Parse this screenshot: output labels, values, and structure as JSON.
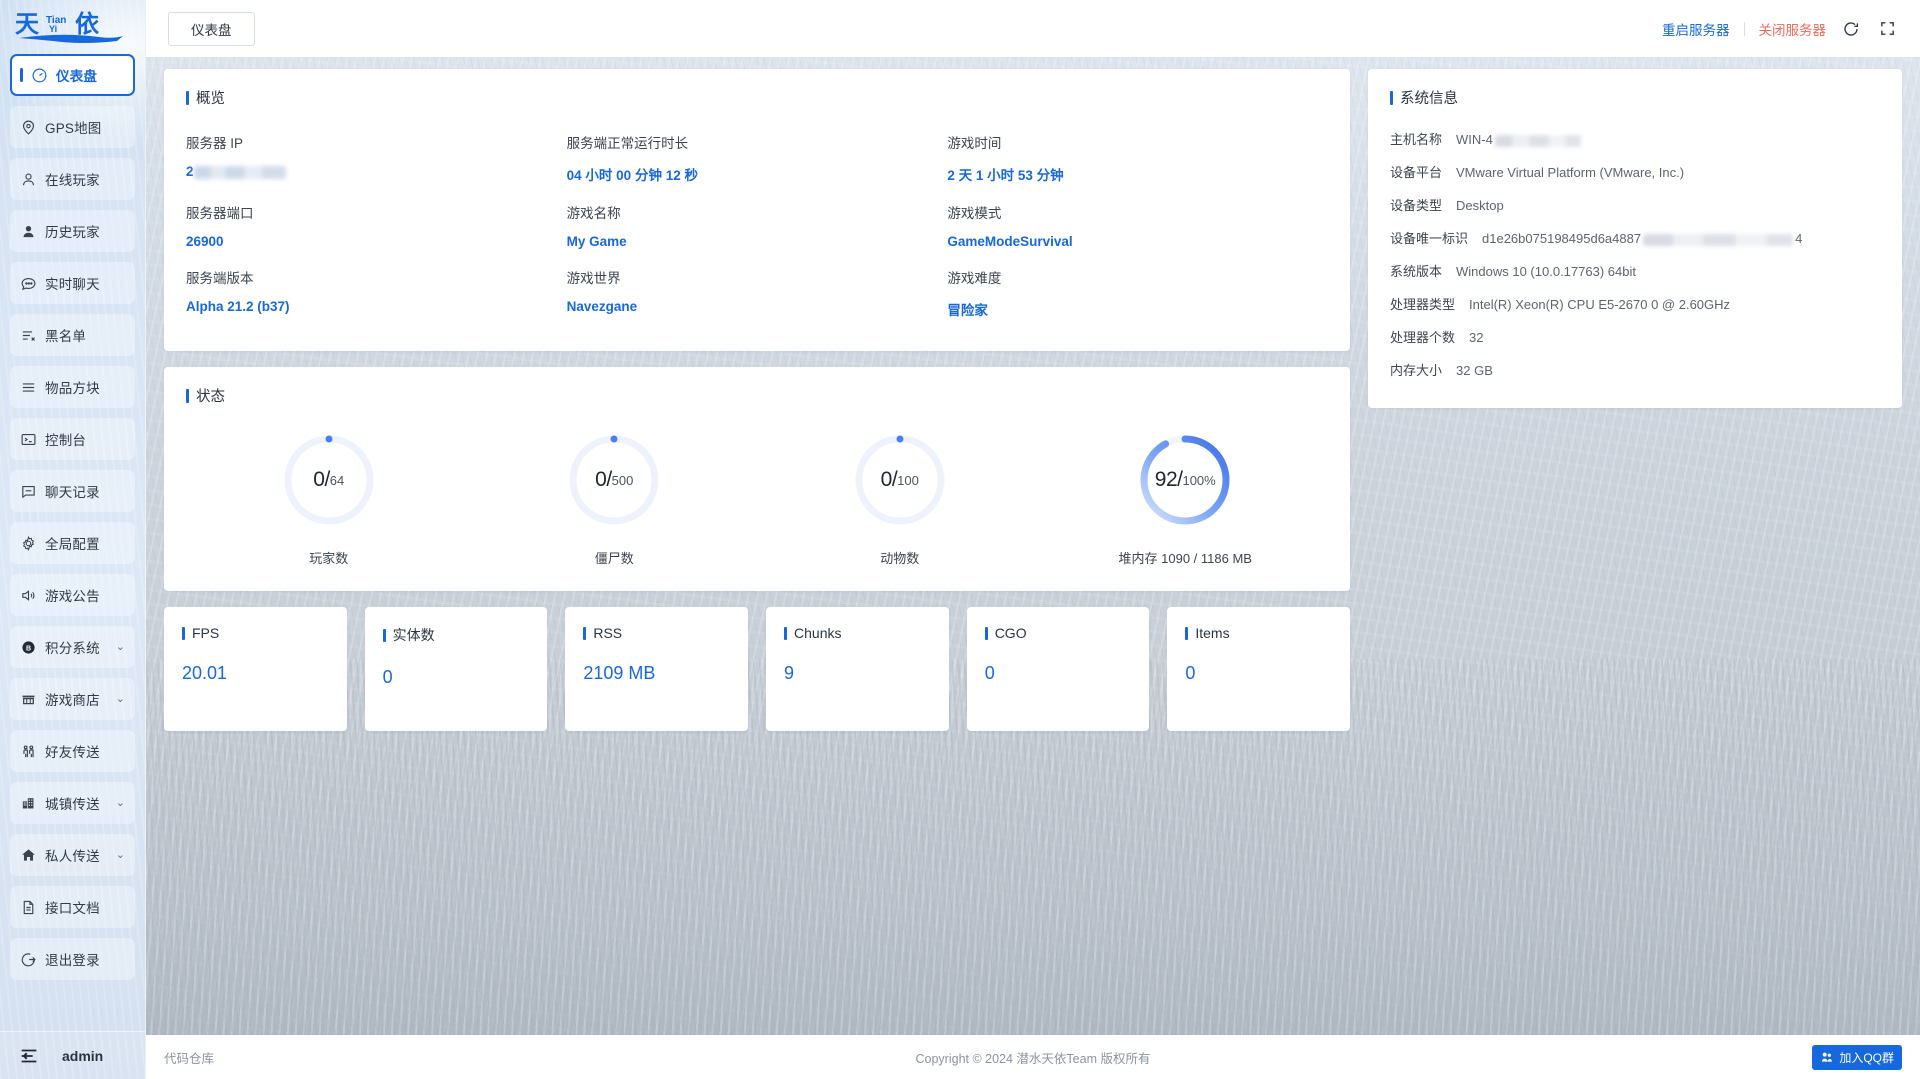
{
  "brand": {
    "logo_primary": "天",
    "logo_pinyin_top": "TIAN",
    "logo_pinyin_bottom": "YI",
    "logo_secondary": "依"
  },
  "sidebar": {
    "items": [
      {
        "label": "仪表盘",
        "icon": "gauge-icon",
        "active": true,
        "expandable": false
      },
      {
        "label": "GPS地图",
        "icon": "map-pin-icon",
        "active": false,
        "expandable": false
      },
      {
        "label": "在线玩家",
        "icon": "user-icon",
        "active": false,
        "expandable": false
      },
      {
        "label": "历史玩家",
        "icon": "user-solid-icon",
        "active": false,
        "expandable": false
      },
      {
        "label": "实时聊天",
        "icon": "chat-icon",
        "active": false,
        "expandable": false
      },
      {
        "label": "黑名单",
        "icon": "list-x-icon",
        "active": false,
        "expandable": false
      },
      {
        "label": "物品方块",
        "icon": "menu-lines-icon",
        "active": false,
        "expandable": false
      },
      {
        "label": "控制台",
        "icon": "terminal-icon",
        "active": false,
        "expandable": false
      },
      {
        "label": "聊天记录",
        "icon": "message-icon",
        "active": false,
        "expandable": false
      },
      {
        "label": "全局配置",
        "icon": "gear-icon",
        "active": false,
        "expandable": false
      },
      {
        "label": "游戏公告",
        "icon": "speaker-icon",
        "active": false,
        "expandable": false
      },
      {
        "label": "积分系统",
        "icon": "coin-icon",
        "active": false,
        "expandable": true
      },
      {
        "label": "游戏商店",
        "icon": "shop-icon",
        "active": false,
        "expandable": true
      },
      {
        "label": "好友传送",
        "icon": "friends-icon",
        "active": false,
        "expandable": false
      },
      {
        "label": "城镇传送",
        "icon": "city-icon",
        "active": false,
        "expandable": true
      },
      {
        "label": "私人传送",
        "icon": "home-icon",
        "active": false,
        "expandable": true
      },
      {
        "label": "接口文档",
        "icon": "doc-icon",
        "active": false,
        "expandable": false
      },
      {
        "label": "退出登录",
        "icon": "logout-icon",
        "active": false,
        "expandable": false
      }
    ],
    "footer": {
      "collapse_icon": "collapse-icon",
      "user": "admin"
    }
  },
  "topbar": {
    "tab_label": "仪表盘",
    "restart_label": "重启服务器",
    "shutdown_label": "关闭服务器",
    "refresh_icon": "refresh-icon",
    "fullscreen_icon": "fullscreen-icon",
    "restart_color": "#1668dc",
    "shutdown_color": "#f26a5d"
  },
  "overview": {
    "title": "概览",
    "fields": [
      {
        "label": "服务器 IP",
        "value": "2",
        "masked": true,
        "type": "ip"
      },
      {
        "label": "服务端正常运行时长",
        "value": "04 小时 00 分钟 12 秒",
        "masked": false,
        "type": "text"
      },
      {
        "label": "游戏时间",
        "value": "2 天 1 小时 53 分钟",
        "masked": false,
        "type": "text"
      },
      {
        "label": "服务器端口",
        "value": "26900",
        "masked": false,
        "type": "text"
      },
      {
        "label": "游戏名称",
        "value": "My Game",
        "masked": false,
        "type": "text"
      },
      {
        "label": "游戏模式",
        "value": "GameModeSurvival",
        "masked": false,
        "type": "text"
      },
      {
        "label": "服务端版本",
        "value": "Alpha 21.2 (b37)",
        "masked": false,
        "type": "text"
      },
      {
        "label": "游戏世界",
        "value": "Navezgane",
        "masked": false,
        "type": "text"
      },
      {
        "label": "游戏难度",
        "value": "冒险家",
        "masked": false,
        "type": "text"
      }
    ]
  },
  "status": {
    "title": "状态",
    "gauges": [
      {
        "value": "0",
        "total": "64",
        "percent": 0,
        "label": "玩家数",
        "unit": ""
      },
      {
        "value": "0",
        "total": "500",
        "percent": 0,
        "label": "僵尸数",
        "unit": ""
      },
      {
        "value": "0",
        "total": "100",
        "percent": 0,
        "label": "动物数",
        "unit": ""
      },
      {
        "value": "92",
        "total": "100",
        "percent": 92,
        "label": "堆内存 1090 / 1186 MB",
        "unit": " %"
      }
    ],
    "accent": "#4c7ef3",
    "track": "#eef3fb"
  },
  "stats": [
    {
      "title": "FPS",
      "value": "20.01"
    },
    {
      "title": "实体数",
      "value": "0"
    },
    {
      "title": "RSS",
      "value": "2109 MB"
    },
    {
      "title": "Chunks",
      "value": "9"
    },
    {
      "title": "CGO",
      "value": "0"
    },
    {
      "title": "Items",
      "value": "0"
    }
  ],
  "system": {
    "title": "系统信息",
    "rows": [
      {
        "label": "主机名称",
        "value": "WIN-4",
        "mask": "short",
        "tail": ""
      },
      {
        "label": "设备平台",
        "value": "VMware Virtual Platform (VMware, Inc.)",
        "mask": "none",
        "tail": ""
      },
      {
        "label": "设备类型",
        "value": "Desktop",
        "mask": "none",
        "tail": ""
      },
      {
        "label": "设备唯一标识",
        "value": "d1e26b075198495d6a4887",
        "mask": "wide",
        "tail": "4"
      },
      {
        "label": "系统版本",
        "value": "Windows 10 (10.0.17763) 64bit",
        "mask": "none",
        "tail": ""
      },
      {
        "label": "处理器类型",
        "value": "Intel(R) Xeon(R) CPU E5-2670 0 @ 2.60GHz",
        "mask": "none",
        "tail": ""
      },
      {
        "label": "处理器个数",
        "value": "32",
        "mask": "none",
        "tail": ""
      },
      {
        "label": "内存大小",
        "value": "32 GB",
        "mask": "none",
        "tail": ""
      }
    ]
  },
  "footer": {
    "repo_label": "代码仓库",
    "copyright": "Copyright © 2024 潜水天依Team 版权所有",
    "qq_label": "加入QQ群"
  }
}
